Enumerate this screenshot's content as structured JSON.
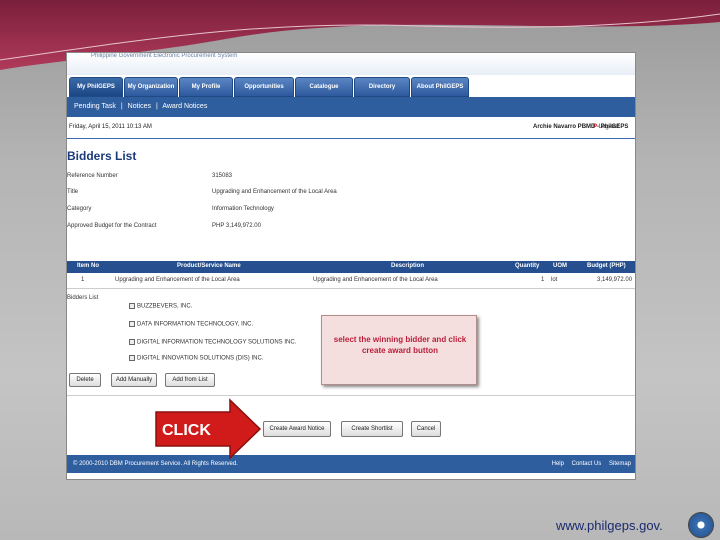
{
  "banner": {
    "text": "Philippine Government Electronic Procurement System"
  },
  "tabs": [
    {
      "label": "My PhilGEPS"
    },
    {
      "label": "My Organization"
    },
    {
      "label": "My Profile"
    },
    {
      "label": "Opportunities"
    },
    {
      "label": "Catalogue"
    },
    {
      "label": "Directory"
    },
    {
      "label": "About PhilGEPS"
    }
  ],
  "subnav": {
    "pending": "Pending Task",
    "sep": "|",
    "notices": "Notices",
    "awarded": "Award Notices"
  },
  "userbar": {
    "date": "Friday, April 15, 2011 10:13 AM",
    "user": "Archie Navarro  PBMD - PhilGEPS",
    "logout_icon": "P",
    "logout": "Log-out"
  },
  "page": {
    "title": "Bidders List",
    "fields": [
      {
        "label": "Reference Number",
        "value": "315083"
      },
      {
        "label": "Title",
        "value": "Upgrading and Enhancement of the Local Area"
      },
      {
        "label": "Category",
        "value": "Information Technology"
      },
      {
        "label": "Approved Budget for the Contract",
        "value": "PHP 3,149,972.00"
      }
    ]
  },
  "table": {
    "headers": {
      "item": "Item No",
      "name": "Product/Service Name",
      "desc": "Description",
      "qty": "Quantity",
      "uom": "UOM",
      "budget": "Budget (PHP)"
    },
    "rows": [
      {
        "item": "1",
        "name": "Upgrading and Enhancement of the Local Area",
        "desc": "Upgrading and Enhancement of the Local Area",
        "qty": "1",
        "uom": "lot",
        "budget": "3,149,972.00"
      }
    ]
  },
  "bidders": {
    "label": "Bidders List",
    "items": [
      {
        "name": "BUZZBEVERS, INC."
      },
      {
        "name": "DATA INFORMATION TECHNOLOGY, INC."
      },
      {
        "name": "DIGITAL INFORMATION TECHNOLOGY SOLUTIONS INC."
      },
      {
        "name": "DIGITAL INNOVATION SOLUTIONS (DIS) INC."
      }
    ]
  },
  "buttons": {
    "delete": "Delete",
    "add_manually": "Add Manually",
    "add_from_list": "Add from List",
    "create_award": "Create Award Notice",
    "create_shortlist": "Create Shortlist",
    "cancel": "Cancel"
  },
  "callout": {
    "text": "select the winning bidder and click create award button"
  },
  "footer": {
    "copyright": "© 2000-2010 DBM Procurement Service. All Rights Reserved.",
    "help": "Help",
    "contact": "Contact Us",
    "sitemap": "Sitemap"
  },
  "arrow": {
    "label": "CLICK",
    "color": "#d11a1a"
  },
  "slide": {
    "url": "www.philgeps.gov."
  }
}
